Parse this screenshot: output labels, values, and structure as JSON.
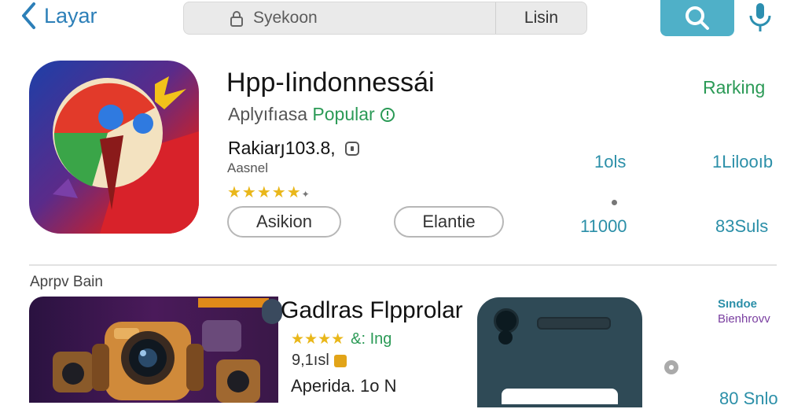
{
  "header": {
    "back_label": "Layar",
    "search_placeholder": "Syekoon",
    "search_button_label": "Lisin"
  },
  "featured": {
    "title": "Hpp-Iindonnessái",
    "subtitle_prefix": "Aplyıfıasa",
    "subtitle_highlight": "Popular",
    "rank_text": "Rakiarյ103.8,",
    "developer": "Aasnel",
    "rating_stars": "★★★★★",
    "rating_extra": "✦",
    "button_primary": "Asikion",
    "button_secondary": "Elantie",
    "ranking_header": "Rarking",
    "stats": [
      "1ols",
      "1Lilooıb",
      "11000",
      "83Suls"
    ]
  },
  "section": {
    "heading": "Aprpv Bain",
    "app_name": "Gadlras Flpprolar",
    "app_stars": "★★★★",
    "app_meta": "&: Ing",
    "app_price": "9,1ısl",
    "app_label": "Aperida. 1o N",
    "right_label_1": "Sındoe",
    "right_label_2": "Bienhrovv",
    "right_label_3": "80 Snlo"
  },
  "colors": {
    "accent": "#2b8fa8",
    "green": "#2b9a56",
    "star": "#e9b71a",
    "search_btn": "#4fb0c8"
  }
}
